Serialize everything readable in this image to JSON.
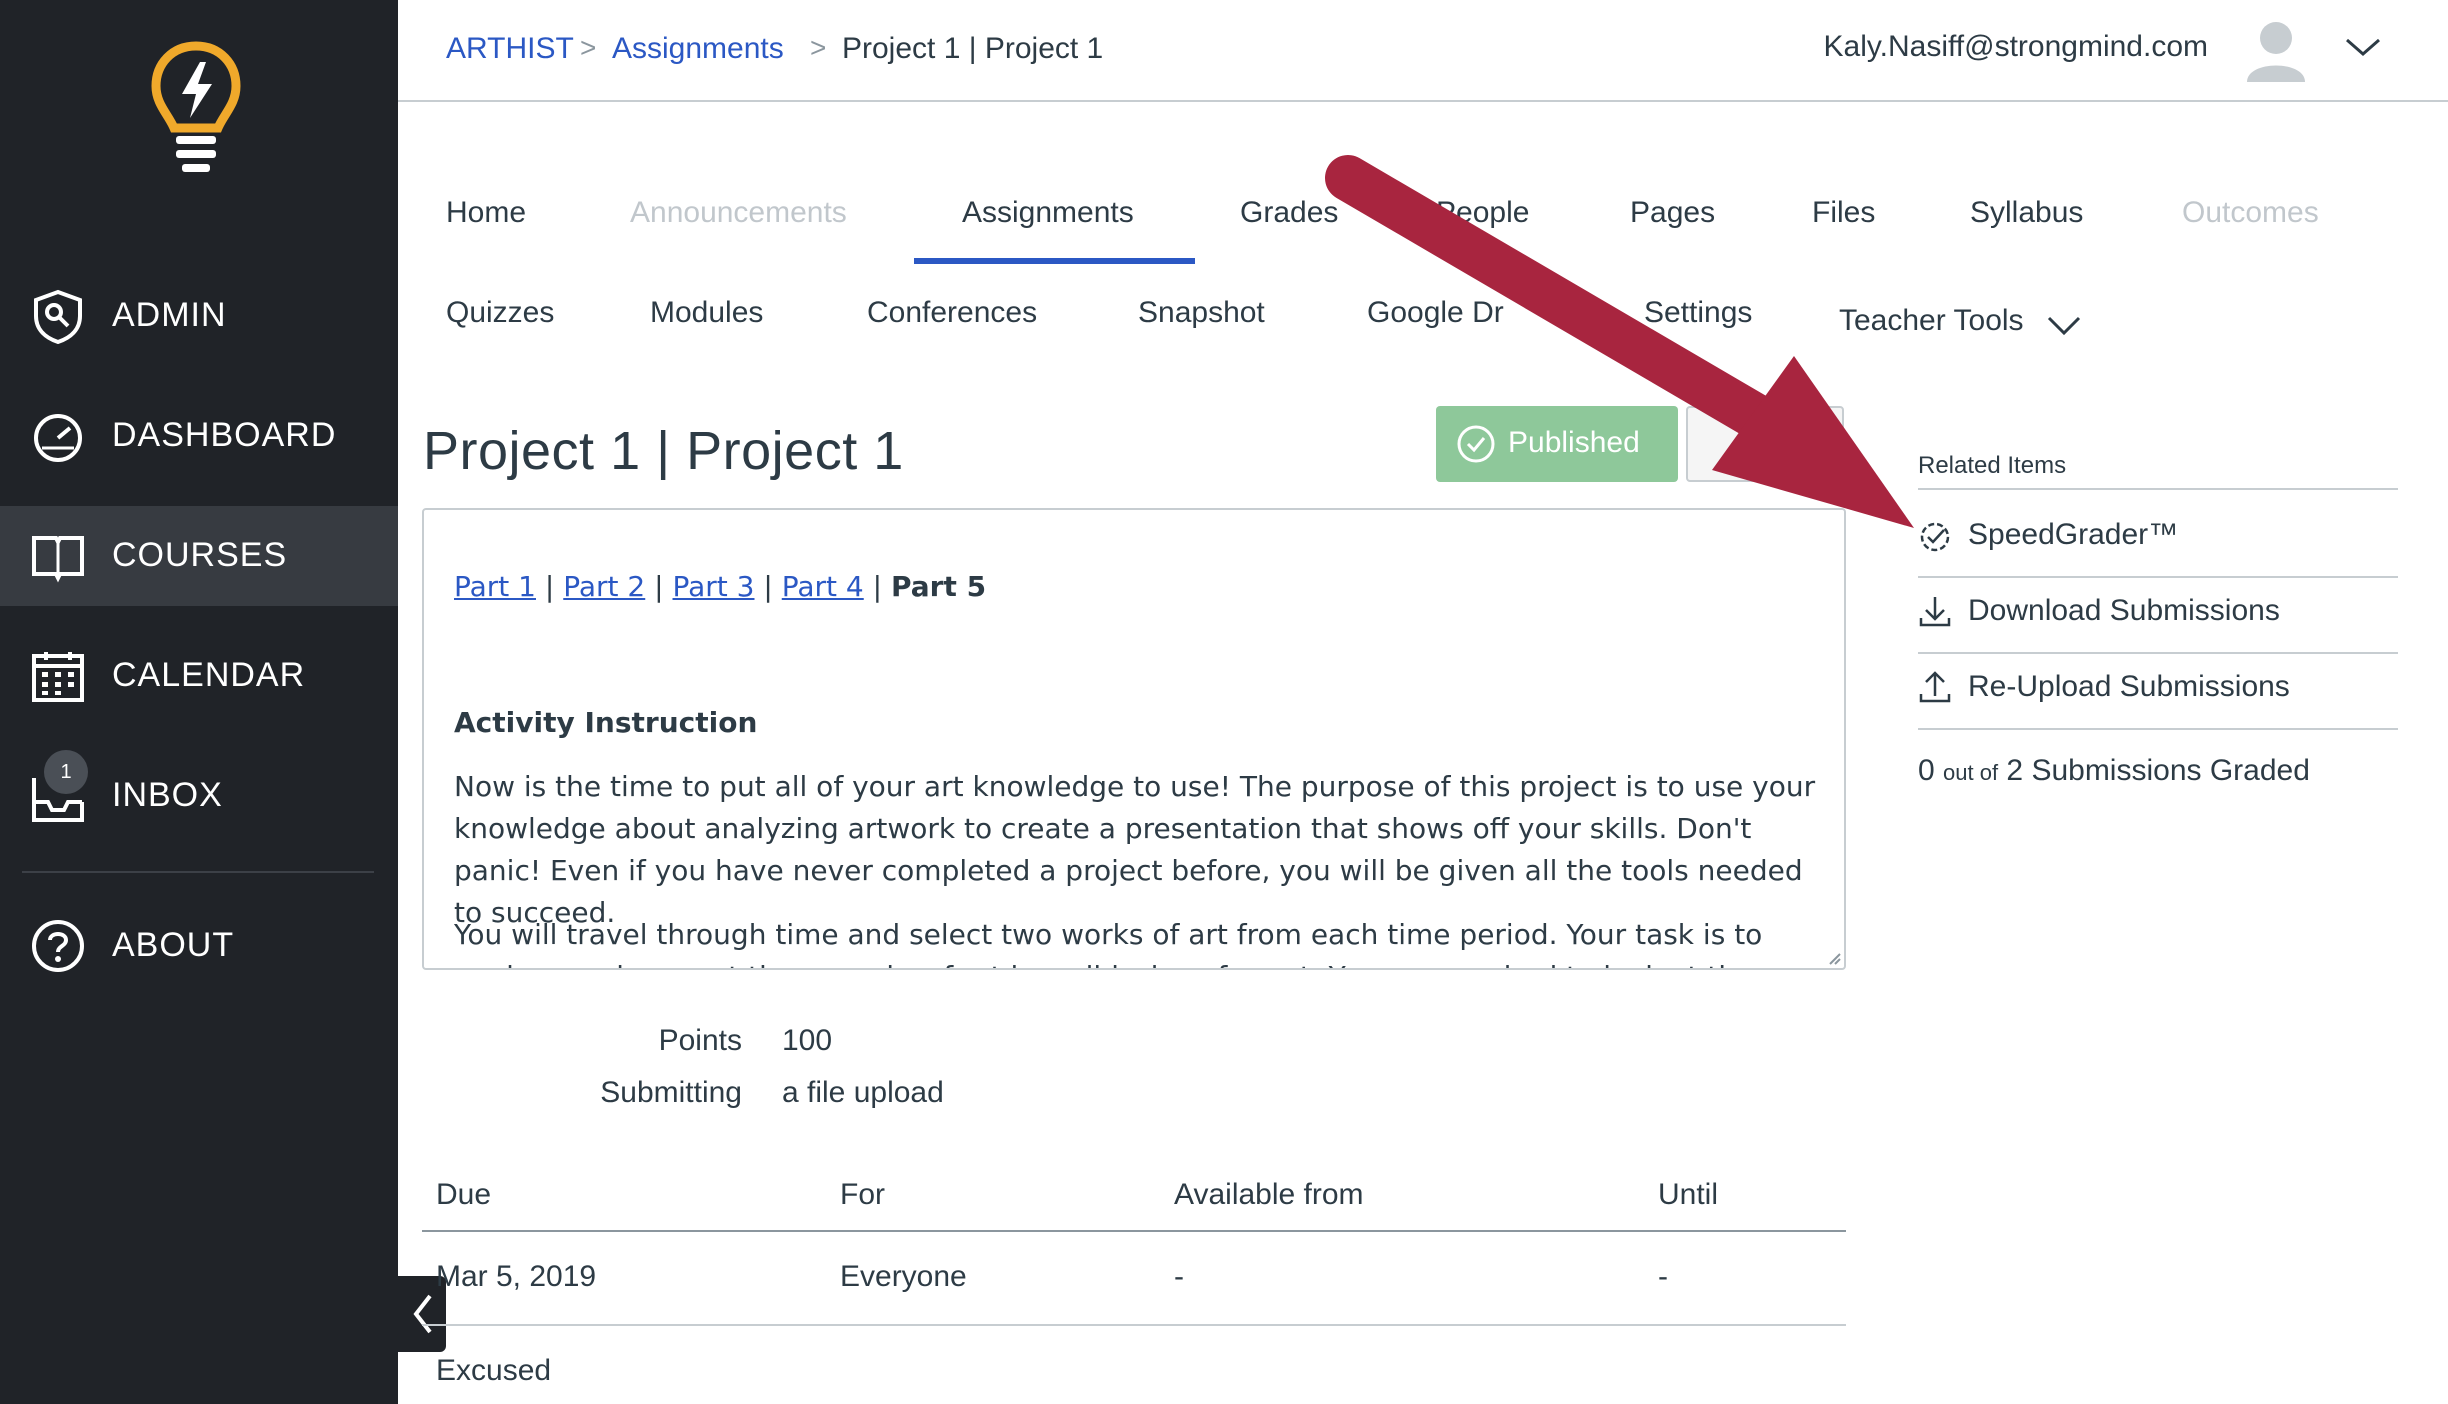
{
  "colors": {
    "sidebar_bg": "#202328",
    "active_bg": "#373b41",
    "link": "#2b58c4",
    "published_bg": "#8ec89a",
    "arrow": "#a8253f",
    "logo": "#f0a92b"
  },
  "sidebar": {
    "items": [
      {
        "label": "ADMIN",
        "icon": "admin-shield-icon"
      },
      {
        "label": "DASHBOARD",
        "icon": "dashboard-gauge-icon"
      },
      {
        "label": "COURSES",
        "icon": "book-icon",
        "active": true
      },
      {
        "label": "CALENDAR",
        "icon": "calendar-icon"
      },
      {
        "label": "INBOX",
        "icon": "inbox-icon",
        "badge": "1"
      },
      {
        "label": "ABOUT",
        "icon": "help-circle-icon"
      }
    ]
  },
  "breadcrumb": {
    "course": "ARTHIST",
    "section": "Assignments",
    "current": "Project 1 | Project 1",
    "sep": ">"
  },
  "user": {
    "email": "Kaly.Nasiff@strongmind.com"
  },
  "tabs": {
    "row1": [
      "Home",
      "Announcements",
      "Assignments",
      "Grades",
      "People",
      "Pages",
      "Files",
      "Syllabus",
      "Outcomes"
    ],
    "row2": [
      "Quizzes",
      "Modules",
      "Conferences",
      "Snapshot",
      "Google Dr",
      "Settings",
      "Teacher Tools"
    ]
  },
  "assignment": {
    "title": "Project 1 | Project 1",
    "published_label": "Published",
    "parts": [
      "Part 1",
      "Part 2",
      "Part 3",
      "Part 4",
      "Part 5"
    ],
    "separator": "|",
    "activity_title": "Activity Instruction",
    "para1": "Now is the time to put all of your art knowledge to use! The purpose of this project is to use your knowledge about analyzing artwork to create a presentation that shows off your skills. Don't panic! Even if you have never completed a project before, you will be given all the tools needed to succeed.",
    "para2": "You will travel through time and select two works of art from each time period. Your task is to analyze and present these works of art in a slideshow format. You are required to look at the artworks and use",
    "points_label": "Points",
    "points_value": "100",
    "submitting_label": "Submitting",
    "submitting_value": "a file upload"
  },
  "dates_table": {
    "headers": [
      "Due",
      "For",
      "Available from",
      "Until"
    ],
    "row": [
      "Mar 5, 2019",
      "Everyone",
      "-",
      "-"
    ],
    "extra": "Excused"
  },
  "related": {
    "title": "Related Items",
    "items": [
      {
        "label": "SpeedGrader™",
        "icon": "speedgrader-icon"
      },
      {
        "label": "Download Submissions",
        "icon": "download-icon"
      },
      {
        "label": "Re-Upload Submissions",
        "icon": "upload-icon"
      }
    ],
    "graded_count": "0",
    "graded_mid": "out of",
    "graded_rest": "2 Submissions Graded"
  }
}
